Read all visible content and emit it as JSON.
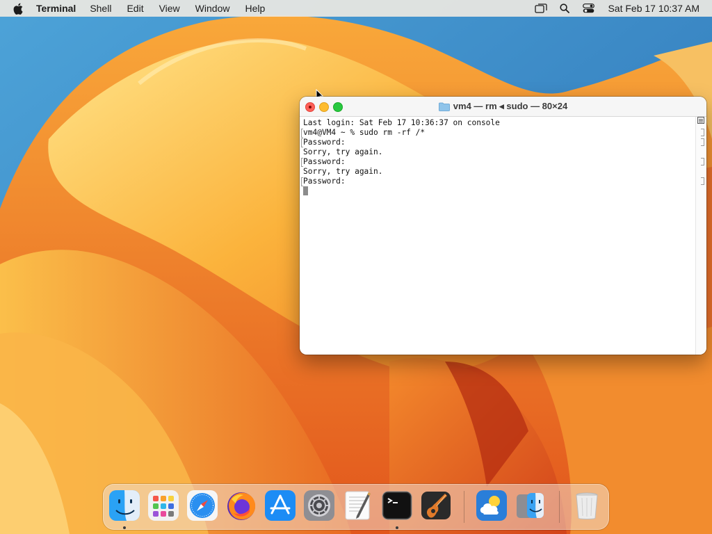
{
  "menubar": {
    "apple_icon": "apple-logo-icon",
    "app_name": "Terminal",
    "menus": [
      "Shell",
      "Edit",
      "View",
      "Window",
      "Help"
    ],
    "status_icons": [
      "screen-mirroring-icon",
      "spotlight-search-icon",
      "control-center-icon"
    ],
    "clock": "Sat Feb 17  10:37 AM"
  },
  "terminal": {
    "title": "vm4 — rm ◂ sudo — 80×24",
    "lines": [
      "Last login: Sat Feb 17 10:36:37 on console",
      "vm4@VM4 ~ % sudo rm -rf /*",
      "Password:",
      "Sorry, try again.",
      "Password:",
      "Sorry, try again.",
      "Password:"
    ],
    "colors": {
      "close": "#ff5f57",
      "minimize": "#febc2e",
      "zoom": "#28c840"
    }
  },
  "dock": {
    "apps": [
      {
        "name": "Finder",
        "icon": "finder-icon",
        "running": true
      },
      {
        "name": "Launchpad",
        "icon": "launchpad-icon",
        "running": false
      },
      {
        "name": "Safari",
        "icon": "safari-icon",
        "running": false
      },
      {
        "name": "Firefox",
        "icon": "firefox-icon",
        "running": false
      },
      {
        "name": "App Store",
        "icon": "app-store-icon",
        "running": false
      },
      {
        "name": "System Settings",
        "icon": "system-settings-icon",
        "running": false
      },
      {
        "name": "TextEdit",
        "icon": "textedit-icon",
        "running": false
      },
      {
        "name": "Terminal",
        "icon": "terminal-icon",
        "running": true
      },
      {
        "name": "GarageBand",
        "icon": "garageband-icon",
        "running": false
      },
      {
        "name": "Weather",
        "icon": "weather-icon",
        "running": false
      },
      {
        "name": "Migration Assistant",
        "icon": "migration-assistant-icon",
        "running": false
      },
      {
        "name": "Trash",
        "icon": "trash-icon",
        "running": false
      }
    ]
  }
}
